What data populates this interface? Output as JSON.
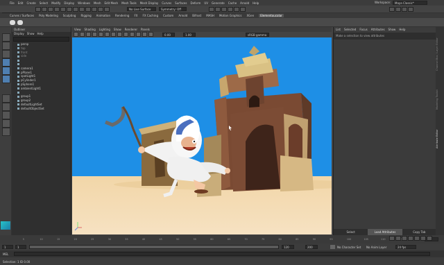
{
  "menubar": {
    "items": [
      "File",
      "Edit",
      "Create",
      "Select",
      "Modify",
      "Display",
      "Windows",
      "Mesh",
      "Edit Mesh",
      "Mesh Tools",
      "Mesh Display",
      "Curves",
      "Surfaces",
      "Deform",
      "UV",
      "Generate",
      "Cache",
      "Arnold",
      "Help"
    ],
    "workspace_label": "Workspace:",
    "workspace_value": "Maya Classic*"
  },
  "statusline": {
    "mode": "Modeling",
    "live_surface": "No Live Surface",
    "symmetry": "Symmetry: Off"
  },
  "shelf": {
    "tabs": [
      "Curves / Surfaces",
      "Poly Modeling",
      "Sculpting",
      "Rigging",
      "Animation",
      "Rendering",
      "FX",
      "FX Caching",
      "Custom",
      "Arnold",
      "Bifrost",
      "MASH",
      "Motion Graphics",
      "XGen",
      "Elementoucolar"
    ],
    "active_tab": "Elementoucolar"
  },
  "outliner": {
    "title": "Outliner",
    "menu": [
      "Display",
      "Show",
      "Help"
    ],
    "items": [
      {
        "label": "persp",
        "dim": false
      },
      {
        "label": "top",
        "dim": true
      },
      {
        "label": "front",
        "dim": true
      },
      {
        "label": "side",
        "dim": true
      },
      {
        "label": "",
        "dim": true
      },
      {
        "label": "",
        "dim": true
      },
      {
        "label": "camera1",
        "dim": false
      },
      {
        "label": "pPlane1",
        "dim": false
      },
      {
        "label": "spotLight1",
        "dim": false
      },
      {
        "label": "pCylinder1",
        "dim": false
      },
      {
        "label": "pSphere1",
        "dim": false
      },
      {
        "label": "ambientLight1",
        "dim": false
      },
      {
        "label": "",
        "dim": true
      },
      {
        "label": "group1",
        "dim": false
      },
      {
        "label": "group2",
        "dim": false
      },
      {
        "label": "defaultLightSet",
        "dim": false
      },
      {
        "label": "defaultObjectSet",
        "dim": false
      }
    ]
  },
  "viewport": {
    "menu": [
      "View",
      "Shading",
      "Lighting",
      "Show",
      "Renderer",
      "Panels"
    ],
    "gamma": "sRGB gamma",
    "exposure": "0.00",
    "gamma_value": "1.00"
  },
  "attribute_editor": {
    "menu": [
      "List",
      "Selected",
      "Focus",
      "Attributes",
      "Show",
      "Help"
    ],
    "message": "Make a selection to view attributes",
    "footer": [
      "Select",
      "Load Attributes",
      "Copy Tab"
    ]
  },
  "side_tabs": [
    "Channel Box / Layer Editor",
    "Modeling Toolkit",
    "Attribute Editor"
  ],
  "timeline": {
    "ticks": [
      "5",
      "10",
      "15",
      "20",
      "25",
      "30",
      "35",
      "40",
      "45",
      "50",
      "55",
      "60",
      "65",
      "70",
      "75",
      "80",
      "85",
      "90",
      "95",
      "100",
      "105",
      "110",
      "115",
      "120"
    ],
    "current_frame": "1"
  },
  "range": {
    "start": "1",
    "start_inner": "1",
    "end_inner": "120",
    "end": "200",
    "character_set": "No Character Set",
    "anim_layer": "No Anim Layer",
    "fps": "24 fps"
  },
  "cmdline": {
    "label": "MEL"
  },
  "helpline": {
    "text": "Selection: 1 ID   0.00"
  },
  "colors": {
    "sky": "#1e8fe6",
    "sand": "#f0d7ae",
    "accent": "#4f7fb0"
  }
}
